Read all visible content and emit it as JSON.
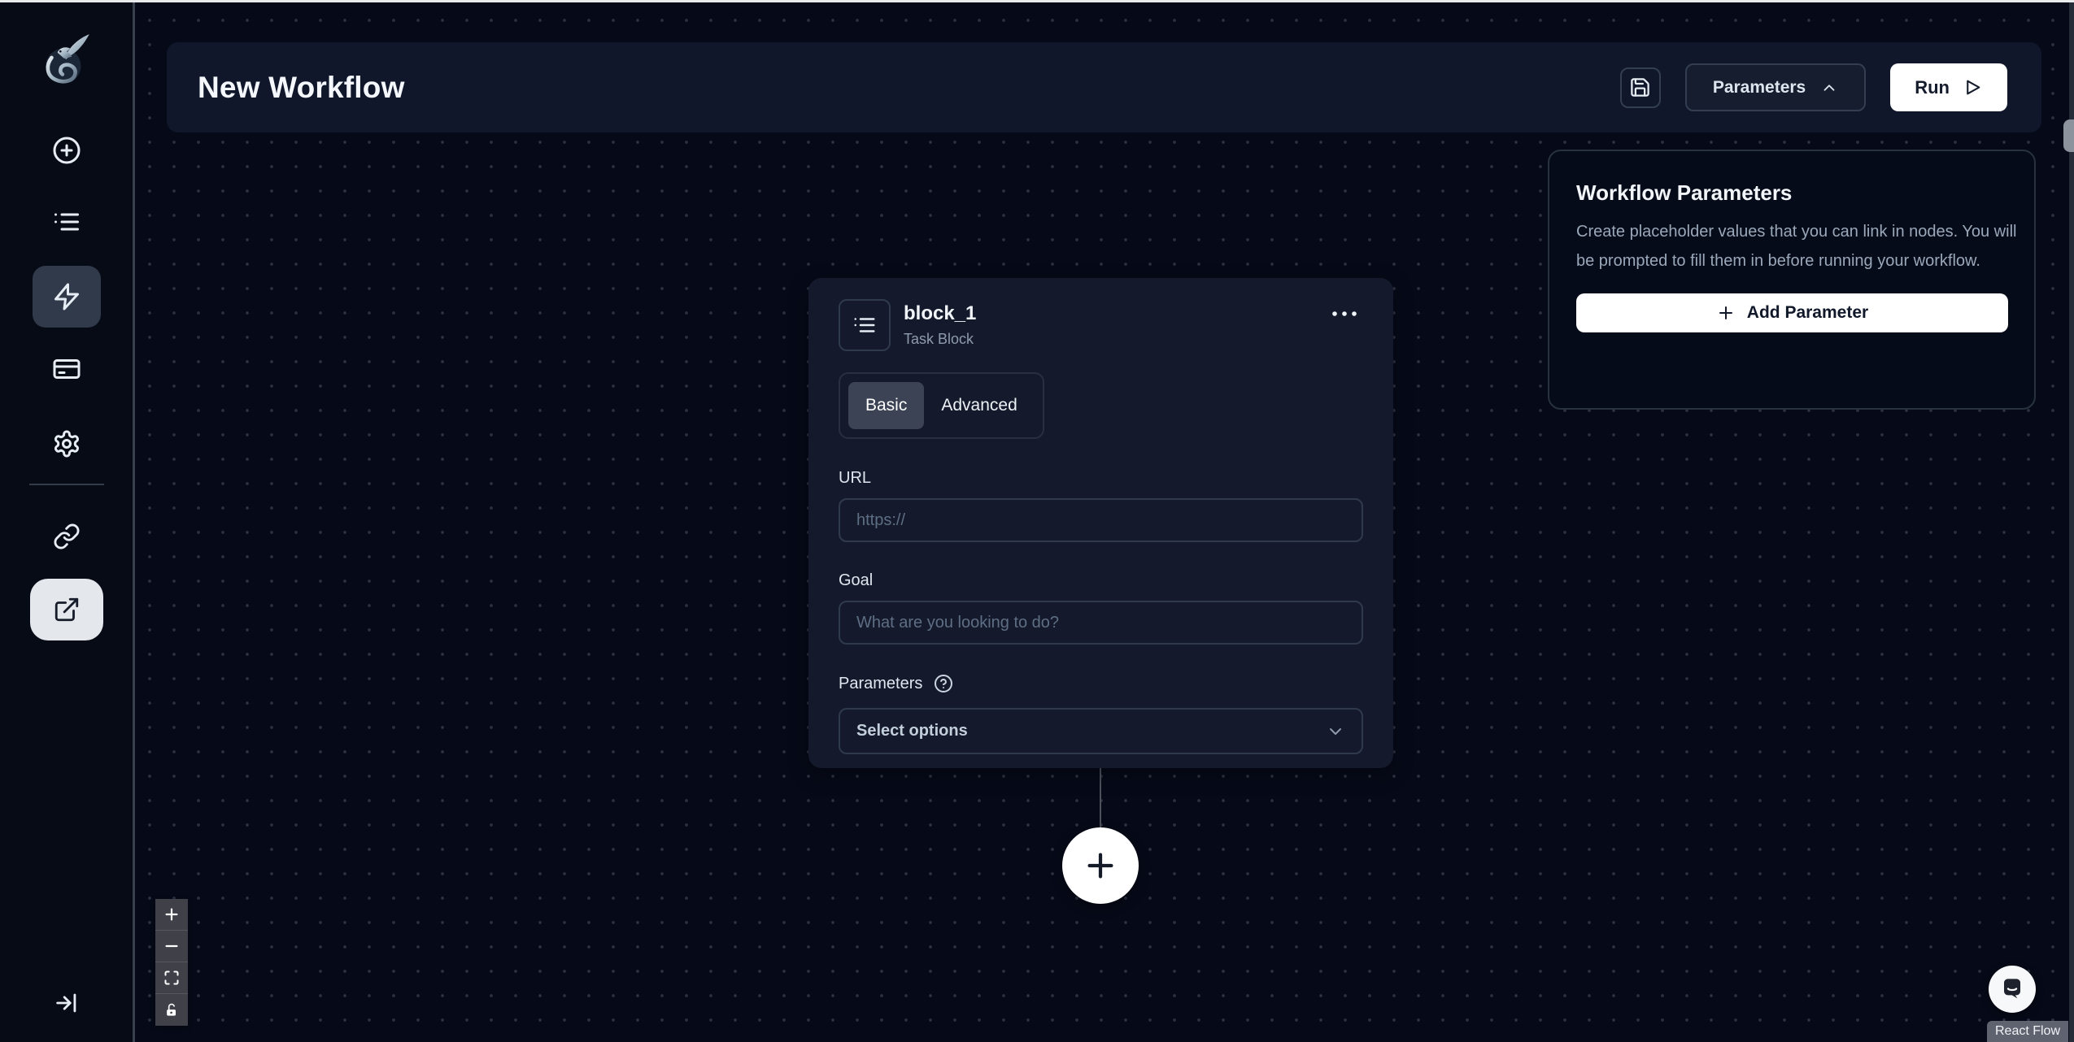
{
  "app": {
    "logo_name": "skyvern-dragon-logo"
  },
  "header": {
    "title": "New Workflow",
    "parameters_button_label": "Parameters",
    "run_button_label": "Run"
  },
  "parameters_panel": {
    "title": "Workflow Parameters",
    "description": "Create placeholder values that you can link in nodes. You will be prompted to fill them in before running your workflow.",
    "add_button_label": "Add Parameter"
  },
  "node": {
    "title": "block_1",
    "subtitle": "Task Block",
    "tab_basic": "Basic",
    "tab_advanced": "Advanced",
    "url_label": "URL",
    "url_placeholder": "https://",
    "goal_label": "Goal",
    "goal_placeholder": "What are you looking to do?",
    "parameters_label": "Parameters",
    "select_placeholder": "Select options"
  },
  "attribution": "React Flow",
  "icons": {
    "sidebar": [
      "circle-plus-icon",
      "list-icon",
      "lightning-icon",
      "credit-card-icon",
      "gear-icon",
      "link-icon",
      "external-link-icon",
      "arrow-right-to-line-icon"
    ],
    "header": [
      "save-icon",
      "chevron-up-icon",
      "play-icon"
    ],
    "controls": [
      "zoom-in-icon",
      "zoom-out-icon",
      "fit-view-icon",
      "lock-open-icon"
    ],
    "misc": [
      "ellipsis-icon",
      "circle-help-icon",
      "chevron-down-icon",
      "plus-icon",
      "chat-bubble-icon"
    ]
  },
  "colors": {
    "canvas_bg": "#060a18",
    "surface": "#10172b",
    "card": "#141a2b",
    "active_tab": "#3b4354",
    "active_sidebar_dark": "#303a4a",
    "active_sidebar_light": "#e4e7ec",
    "border": "#2f3a4d",
    "muted_text": "#9aa8ba",
    "placeholder_text": "#5e6e84",
    "white": "#ffffff"
  }
}
